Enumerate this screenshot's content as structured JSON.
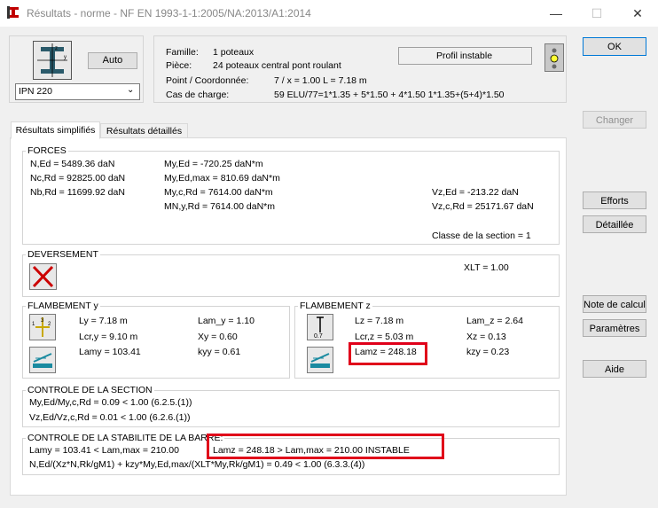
{
  "window": {
    "title": "Résultats - norme - NF EN 1993-1-1:2005/NA:2013/A1:2014",
    "minimize": "—",
    "maximize": "☐",
    "close": "✕"
  },
  "profile": {
    "auto_button": "Auto",
    "section_select": "IPN 220"
  },
  "info": {
    "famille_label": "Famille:",
    "famille_value": "1  poteaux",
    "piece_label": "Pièce:",
    "piece_value": "24  poteaux central pont roulant",
    "point_label": "Point / Coordonnée:",
    "point_value": "7 / x = 1.00 L = 7.18 m",
    "cas_label": "Cas de charge:",
    "cas_value": "59 ELU/77=1*1.35 + 5*1.50 + 4*1.50  1*1.35+(5+4)*1.50",
    "status": "Profil instable"
  },
  "right_buttons": {
    "ok": "OK",
    "changer": "Changer",
    "efforts": "Efforts",
    "detaillee": "Détaillée",
    "note": "Note de calcul",
    "parametres": "Paramètres",
    "aide": "Aide"
  },
  "tabs": [
    "Résultats simplifiés",
    "Résultats détaillés"
  ],
  "forces": {
    "title": "FORCES",
    "col1": [
      "N,Ed = 5489.36 daN",
      "Nc,Rd = 92825.00 daN",
      "Nb,Rd = 11699.92 daN"
    ],
    "col2": [
      "My,Ed = -720.25 daN*m",
      "My,Ed,max = 810.69 daN*m",
      "My,c,Rd = 7614.00 daN*m",
      "MN,y,Rd = 7614.00 daN*m"
    ],
    "col3": [
      "Vz,Ed = -213.22 daN",
      "Vz,c,Rd = 25171.67 daN"
    ],
    "classe": "Classe de la section = 1"
  },
  "deversement": {
    "title": "DEVERSEMENT",
    "xlt": "XLT = 1.00"
  },
  "flambement_y": {
    "title": "FLAMBEMENT y",
    "ly": "Ly = 7.18 m",
    "lcr": "Lcr,y = 9.10 m",
    "lam": "Lamy = 103.41",
    "lam_bar": "Lam_y = 1.10",
    "x": "Xy = 0.60",
    "k": "kyy = 0.61"
  },
  "flambement_z": {
    "title": "FLAMBEMENT z",
    "lz": "Lz = 7.18 m",
    "lcr": "Lcr,z = 5.03 m",
    "lam": "Lamz = 248.18",
    "lam_bar": "Lam_z = 2.64",
    "x": "Xz = 0.13",
    "k": "kzy = 0.23",
    "icon_label": "0.7"
  },
  "controle_section": {
    "title": "CONTROLE DE LA SECTION",
    "line1": "My,Ed/My,c,Rd = 0.09 < 1.00   (6.2.5.(1))",
    "line2": "Vz,Ed/Vz,c,Rd = 0.01 < 1.00   (6.2.6.(1))"
  },
  "controle_stabilite": {
    "title": "CONTROLE DE LA STABILITE DE LA BARRE:",
    "line1a": "Lamy = 103.41 < Lam,max = 210.00",
    "line1b": "Lamz = 248.18 > Lam,max = 210.00    INSTABLE",
    "line2": "N,Ed/(Xz*N,Rk/gM1) + kzy*My,Ed,max/(XLT*My,Rk/gM1) = 0.49 < 1.00   (6.3.3.(4))"
  },
  "colors": {
    "highlight": "#e0001a",
    "traffic_light": "#ffff33"
  }
}
